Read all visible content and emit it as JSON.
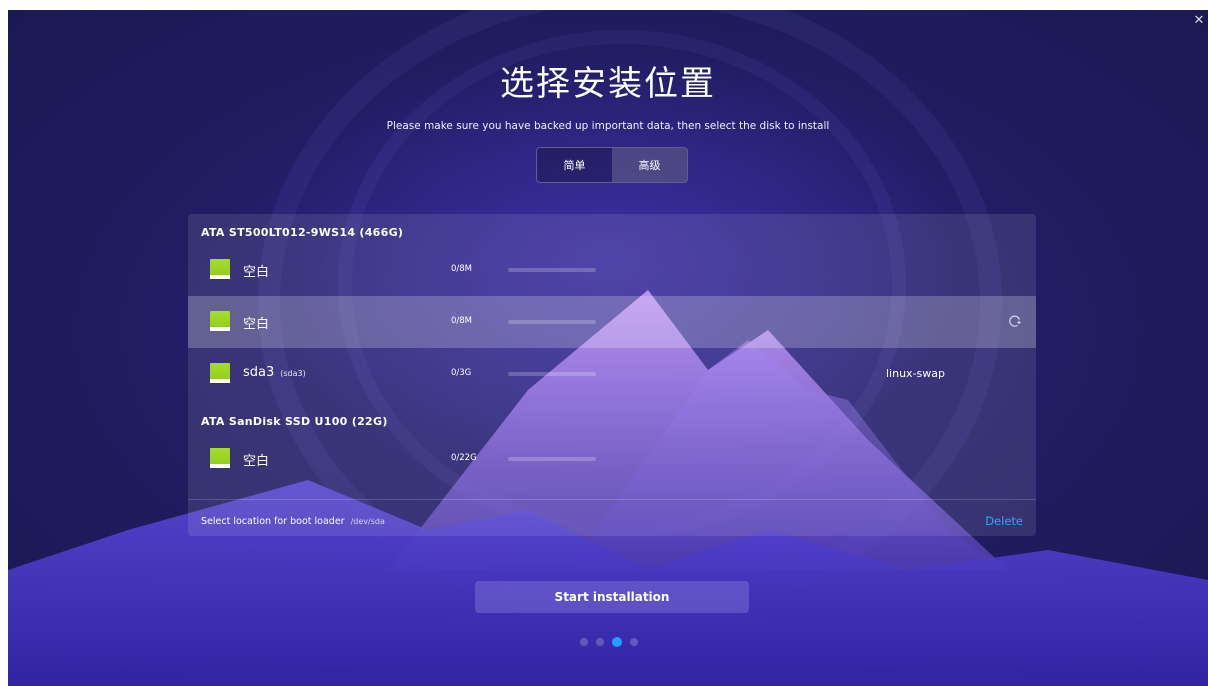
{
  "window": {
    "close_icon": "close-icon"
  },
  "header": {
    "title": "选择安装位置",
    "subtitle": "Please make sure you have backed up important data, then select the disk to install"
  },
  "mode_tabs": [
    {
      "label": "简单",
      "active": false
    },
    {
      "label": "高级",
      "active": true
    }
  ],
  "disks": [
    {
      "name": "ATA ST500LT012-9WS14 (466G)",
      "partitions": [
        {
          "label": "空白",
          "device": "",
          "usage": "0/8M",
          "fill_percent": 0,
          "filesystem": "",
          "selected": false
        },
        {
          "label": "空白",
          "device": "",
          "usage": "0/8M",
          "fill_percent": 0,
          "filesystem": "",
          "selected": true,
          "action_icon": "new-partition-icon"
        },
        {
          "label": "sda3",
          "device": "(sda3)",
          "usage": "0/3G",
          "fill_percent": 0,
          "filesystem": "linux-swap",
          "selected": false
        }
      ]
    },
    {
      "name": "ATA SanDisk SSD U100 (22G)",
      "partitions": [
        {
          "label": "空白",
          "device": "",
          "usage": "0/22G",
          "fill_percent": 0,
          "filesystem": "",
          "selected": false
        }
      ]
    }
  ],
  "bootloader": {
    "label": "Select location for boot loader",
    "device": "/dev/sda"
  },
  "delete_label": "Delete",
  "start_button": "Start installation",
  "pagination": {
    "total": 4,
    "current": 3
  },
  "colors": {
    "accent": "#2aa8ff",
    "partition_icon": "#9bd42a",
    "background": "#1f1c5e"
  }
}
